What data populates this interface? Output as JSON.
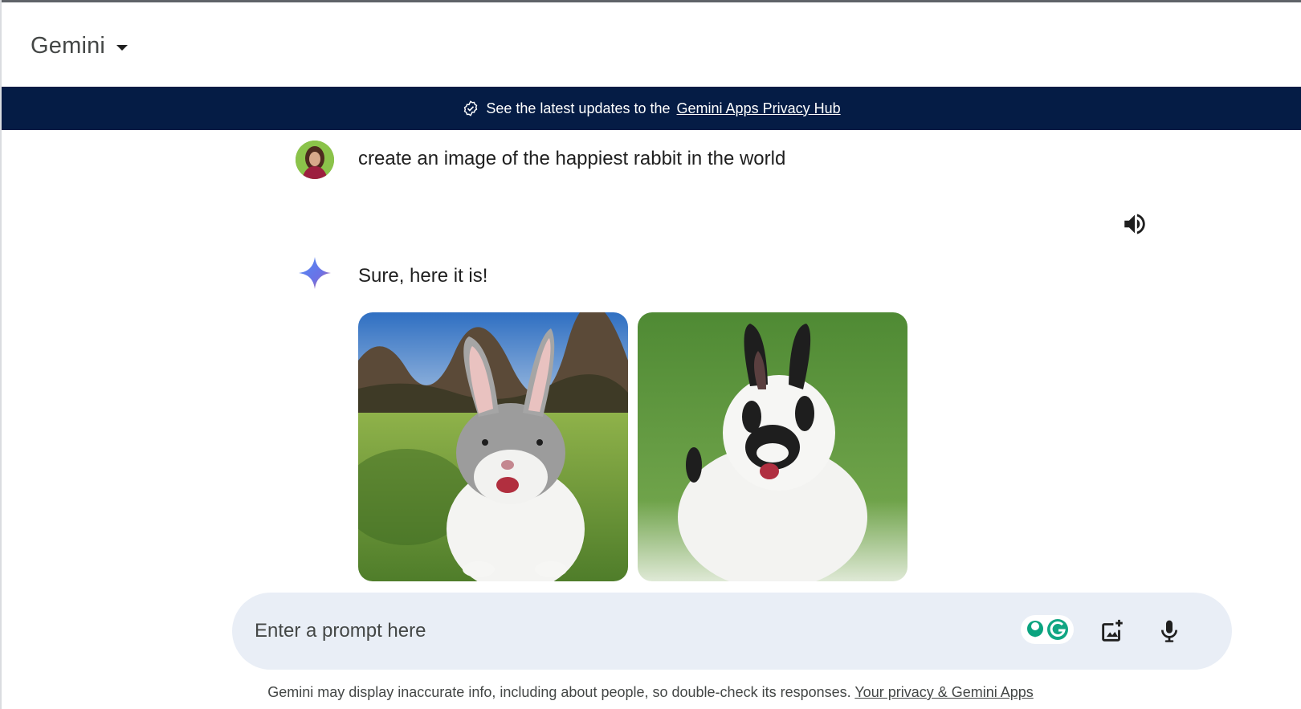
{
  "header": {
    "title": "Gemini"
  },
  "banner": {
    "text": "See the latest updates to the",
    "link": "Gemini Apps Privacy Hub"
  },
  "conversation": {
    "user_prompt": "create an image of the happiest rabbit in the world",
    "model_reply": "Sure, here it is!",
    "images": [
      {
        "icon": "gray-white-rabbit-image"
      },
      {
        "icon": "black-white-rabbit-image"
      }
    ]
  },
  "input": {
    "placeholder": "Enter a prompt here",
    "value": ""
  },
  "footer": {
    "disclaimer": "Gemini may display inaccurate info, including about people, so double-check its responses.",
    "link": "Your privacy & Gemini Apps"
  },
  "colors": {
    "banner_bg": "#051c45",
    "prompt_bg": "#e9eef6",
    "accent": "#4285f4"
  }
}
